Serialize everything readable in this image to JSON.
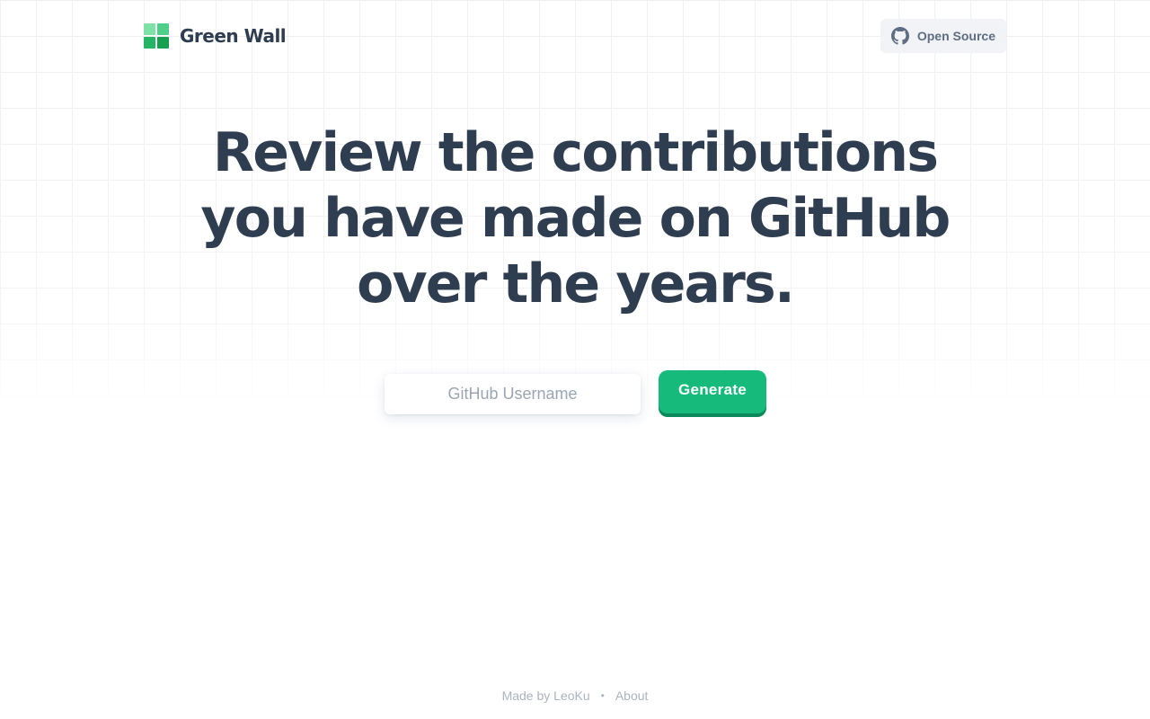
{
  "header": {
    "brand_name": "Green Wall",
    "logo_icon": "green-wall-logo-icon",
    "logo_colors": [
      "#7ee2a6",
      "#4fd08a",
      "#26b566",
      "#14a050"
    ],
    "open_source_label": "Open Source",
    "open_source_icon": "github-icon"
  },
  "hero": {
    "title_lines": [
      "Review the contributions",
      "you have made on GitHub",
      "over the years."
    ]
  },
  "form": {
    "username_placeholder": "GitHub Username",
    "username_value": "",
    "generate_label": "Generate"
  },
  "footer": {
    "made_by": "Made by LeoKu",
    "separator": "•",
    "about": "About"
  },
  "colors": {
    "text": "#2f3d50",
    "accent": "#16bb7c",
    "accent_shadow": "#0a8a5a",
    "muted": "#aab3c0"
  }
}
